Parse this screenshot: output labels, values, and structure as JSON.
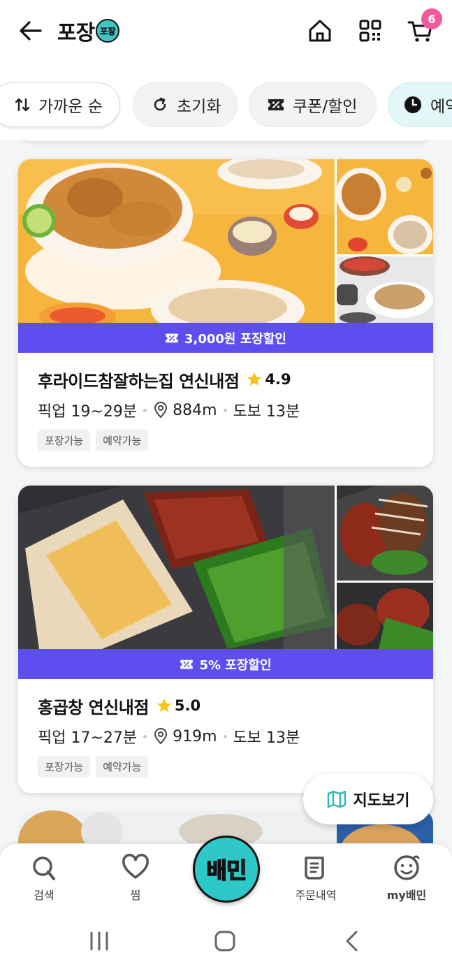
{
  "header": {
    "logo_text": "포장",
    "logo_badge": "포장",
    "cart_count": "6",
    "icons": [
      "back-arrow-icon",
      "home-icon",
      "qr-code-icon",
      "cart-icon"
    ]
  },
  "filters": [
    {
      "label": "가까운 순",
      "icon": "sort-icon"
    },
    {
      "label": "초기화",
      "icon": "refresh-icon"
    },
    {
      "label": "쿠폰/할인",
      "icon": "coupon-icon"
    },
    {
      "label": "예약",
      "icon": "clock-icon"
    }
  ],
  "stores": [
    {
      "promo": "3,000원 포장할인",
      "name": "후라이드참잘하는집 연신내점",
      "rating": "4.9",
      "pickup": "픽업 19~29분",
      "distance": "884m",
      "walk": "도보 13분",
      "tags": [
        "포장가능",
        "예약가능"
      ]
    },
    {
      "promo": "5% 포장할인",
      "name": "홍곱창 연신내점",
      "rating": "5.0",
      "pickup": "픽업 17~27분",
      "distance": "919m",
      "walk": "도보 13분",
      "tags": [
        "포장가능",
        "예약가능"
      ]
    }
  ],
  "map_button": "지도보기",
  "bottom_nav": {
    "search": "검색",
    "wishlist": "찜",
    "center": "배민",
    "orders": "주문내역",
    "my": "my배민"
  },
  "colors": {
    "promo_bar": "#5d4ef0",
    "brand_mint": "#2ec8c8",
    "cart_badge": "#f05a9b",
    "star": "#f5c518"
  }
}
